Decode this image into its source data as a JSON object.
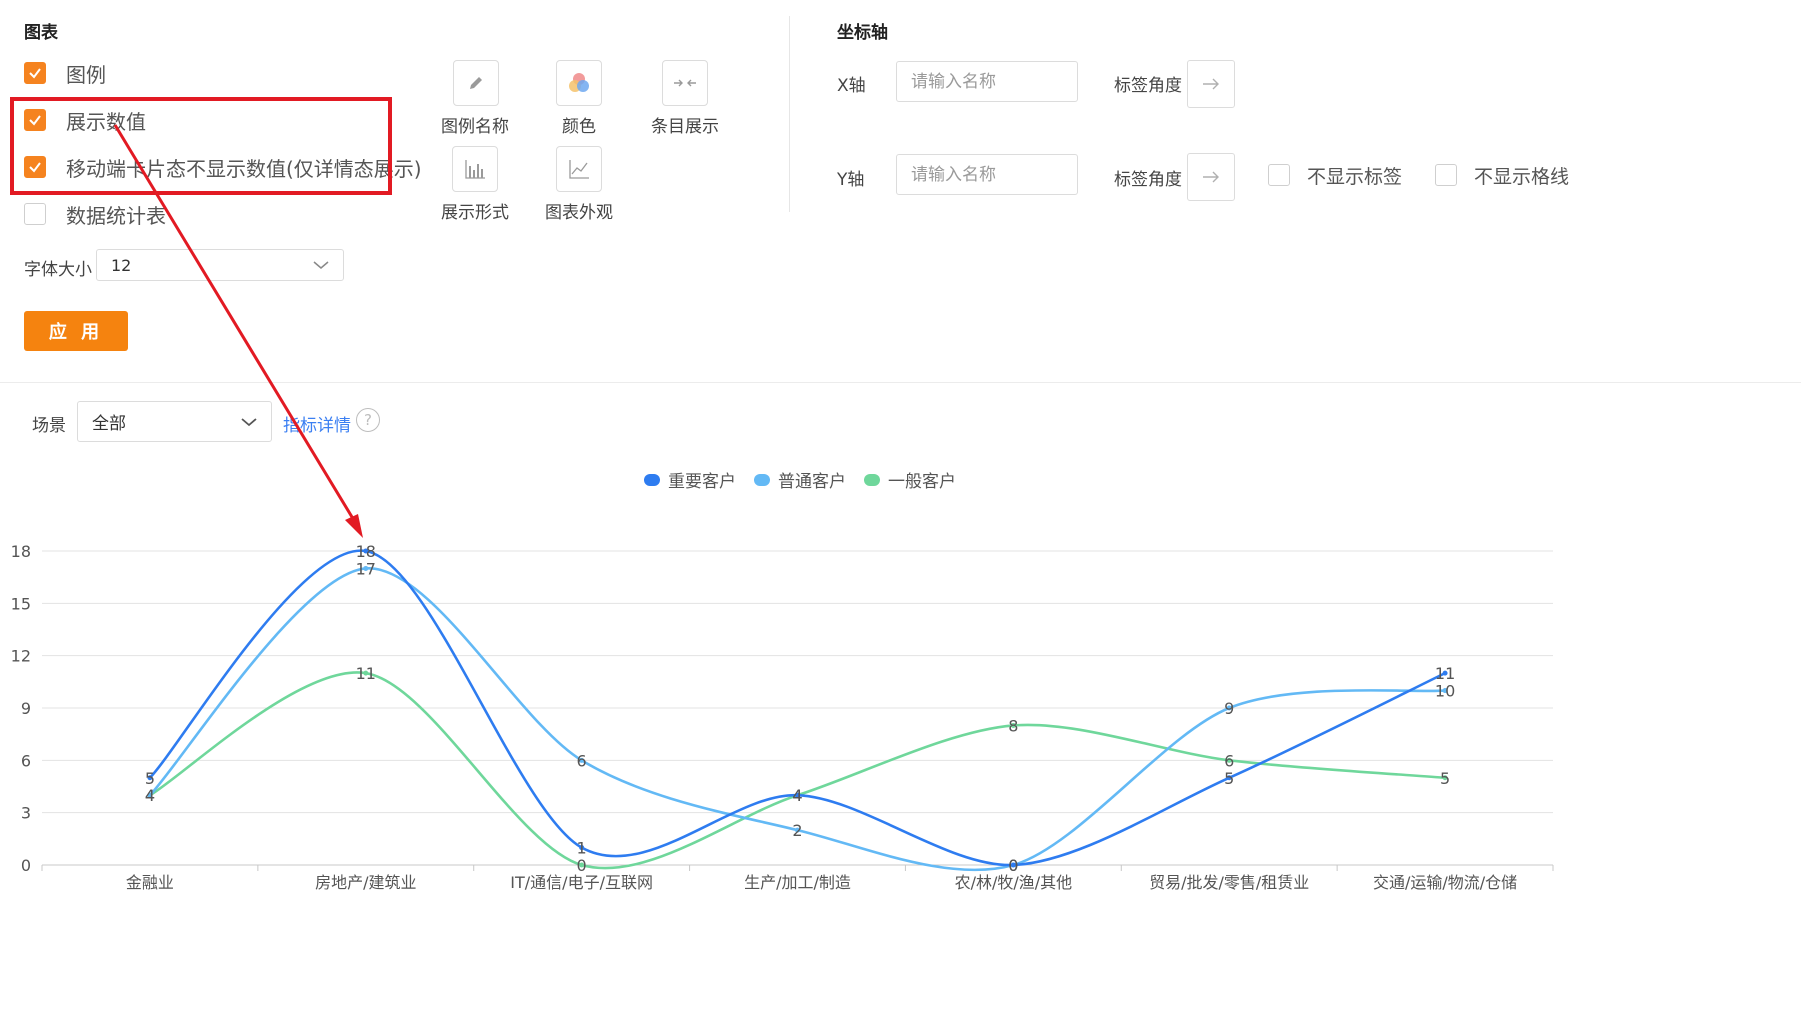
{
  "panel": {
    "chart_section_title": "图表",
    "axis_section_title": "坐标轴",
    "checkboxes": [
      {
        "label": "图例",
        "checked": true
      },
      {
        "label": "展示数值",
        "checked": true
      },
      {
        "label": "移动端卡片态不显示数值(仅详情态展示)",
        "checked": true
      },
      {
        "label": "数据统计表",
        "checked": false
      }
    ],
    "font_size_label": "字体大小",
    "font_size_value": "12",
    "apply_label": "应 用",
    "tools": [
      {
        "label": "图例名称",
        "icon": "pencil-icon"
      },
      {
        "label": "颜色",
        "icon": "color-palette-icon"
      },
      {
        "label": "条目展示",
        "icon": "collapse-arrows-icon"
      },
      {
        "label": "展示形式",
        "icon": "bar-chart-icon"
      },
      {
        "label": "图表外观",
        "icon": "line-chart-icon"
      }
    ],
    "x_axis": {
      "label": "X轴",
      "placeholder": "请输入名称",
      "angle_label": "标签角度"
    },
    "y_axis": {
      "label": "Y轴",
      "placeholder": "请输入名称",
      "angle_label": "标签角度"
    },
    "hide_label": "不显示标签",
    "hide_grid": "不显示格线"
  },
  "filter": {
    "scene_label": "场景",
    "scene_value": "全部",
    "metric_link": "指标详情",
    "help_glyph": "?"
  },
  "colors": {
    "accent": "#f5831f",
    "highlight": "#e21a23",
    "link": "#3b7ff2"
  },
  "chart_data": {
    "type": "line",
    "smooth": true,
    "categories": [
      "金融业",
      "房地产/建筑业",
      "IT/通信/电子/互联网",
      "生产/加工/制造",
      "农/林/牧/渔/其他",
      "贸易/批发/零售/租赁业",
      "交通/运输/物流/仓储"
    ],
    "series": [
      {
        "name": "重要客户",
        "color": "#2e7cf0",
        "values": [
          5,
          18,
          1,
          4,
          0,
          5,
          11
        ]
      },
      {
        "name": "普通客户",
        "color": "#63b9f5",
        "values": [
          4,
          17,
          6,
          2,
          0,
          9,
          10
        ]
      },
      {
        "name": "一般客户",
        "color": "#6fd79b",
        "values": [
          4,
          11,
          0,
          4,
          8,
          6,
          5
        ]
      }
    ],
    "ylim": [
      0,
      18
    ],
    "yticks": [
      0,
      3,
      6,
      9,
      12,
      15,
      18
    ],
    "grid": true,
    "legend_position": "top-center",
    "show_values": true
  }
}
